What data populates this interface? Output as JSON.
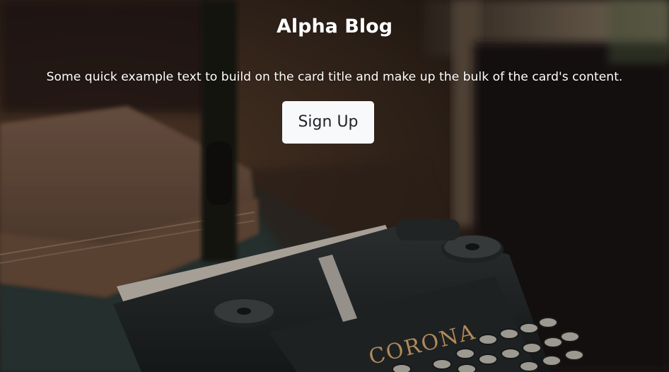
{
  "card": {
    "title": "Alpha Blog",
    "text": "Some quick example text to build on the card title and make up the bulk of the card's content.",
    "signup_label": "Sign Up"
  },
  "background": {
    "description_icon": "typewriter-photo",
    "brand_text": "CORONA"
  },
  "colors": {
    "text": "#ffffff",
    "button_bg": "#f8f9fa",
    "button_text": "#212529"
  }
}
